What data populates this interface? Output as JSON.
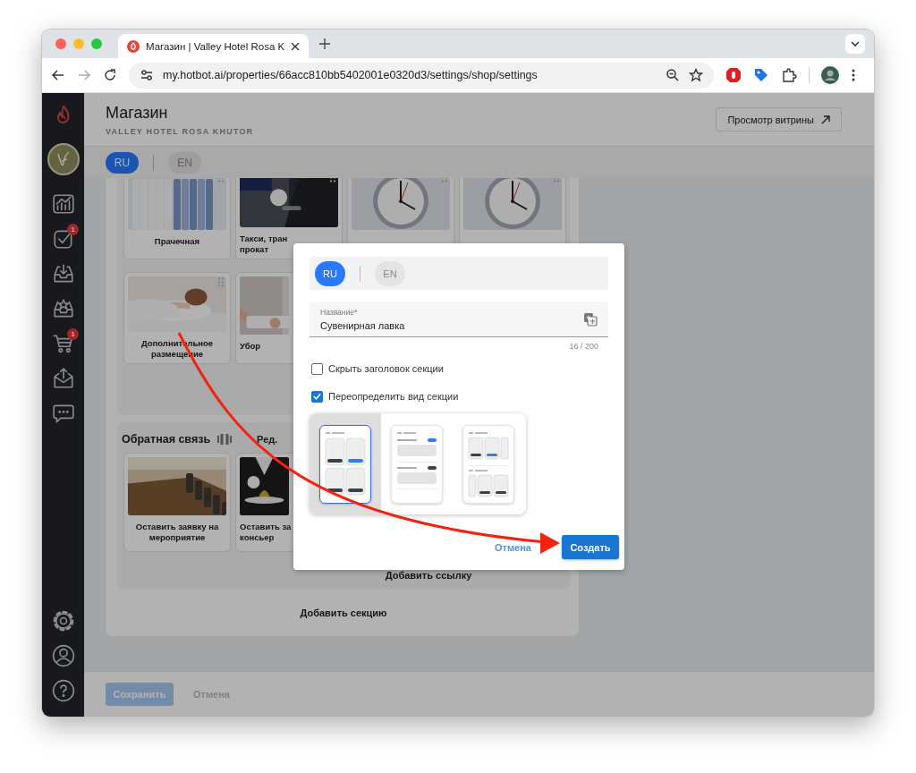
{
  "browser": {
    "tab_title": "Магазин | Valley Hotel Rosa K",
    "url": "my.hotbot.ai/properties/66acc810bb5402001e0320d3/settings/shop/settings"
  },
  "sidebar": {
    "items": [
      {
        "kind": "analytics"
      },
      {
        "kind": "tasks",
        "badge": "1"
      },
      {
        "kind": "inbox-download"
      },
      {
        "kind": "inbox-star"
      },
      {
        "kind": "cart",
        "badge": "1"
      },
      {
        "kind": "mail-upload"
      },
      {
        "kind": "chat"
      }
    ],
    "bottom_items": [
      {
        "kind": "settings"
      },
      {
        "kind": "profile"
      },
      {
        "kind": "help"
      }
    ]
  },
  "header": {
    "title": "Магазин",
    "subtitle": "VALLEY HOTEL ROSA KHUTOR",
    "preview_button": "Просмотр витрины"
  },
  "languages": [
    {
      "label": "RU",
      "selected": true
    },
    {
      "label": "EN",
      "selected": false
    }
  ],
  "sections": [
    {
      "cards": [
        {
          "kind": "picture",
          "lines": [
            "Прачечная"
          ]
        },
        {
          "kind": "picture",
          "lines": [
            "Такси, тран",
            "прокат"
          ]
        },
        {
          "kind": "picture"
        },
        {
          "kind": "picture"
        },
        {
          "kind": "picture",
          "lines": [
            "Дополнительное",
            "размещение"
          ]
        },
        {
          "kind": "picture",
          "lines": [
            "Убор"
          ]
        }
      ]
    },
    {
      "title": "Обратная связь",
      "edit": "Ред.",
      "cards": [
        {
          "kind": "picture",
          "lines": [
            "Оставить заявку на",
            "мероприятие"
          ]
        },
        {
          "kind": "picture",
          "lines": [
            "Оставить за",
            "консьер"
          ]
        }
      ],
      "add_link": "Добавить ссылку"
    }
  ],
  "add_section": "Добавить секцию",
  "footer": {
    "save": "Сохранить",
    "cancel": "Отмена"
  },
  "dialog": {
    "languages": [
      {
        "label": "RU",
        "selected": true
      },
      {
        "label": "EN",
        "selected": false
      }
    ],
    "name_field": {
      "label": "Название*",
      "value": "Сувенирная лавка",
      "counter": "16 / 200"
    },
    "options": [
      {
        "label": "Скрыть заголовок секции",
        "checked": false
      },
      {
        "label": "Переопределить вид секции",
        "checked": true
      }
    ],
    "layouts": [
      {
        "kind": "grid",
        "selected": true
      },
      {
        "kind": "list",
        "selected": false
      },
      {
        "kind": "carousel",
        "selected": false
      }
    ],
    "cancel": "Отмена",
    "create": "Создать"
  }
}
